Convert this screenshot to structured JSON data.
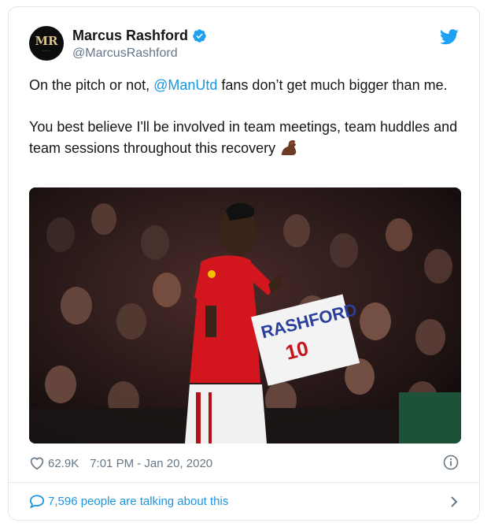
{
  "account": {
    "display_name": "Marcus Rashford",
    "handle": "@MarcusRashford",
    "avatar_monogram": "MR",
    "verified": true
  },
  "tweet": {
    "line1_before": "On the pitch or not, ",
    "mention": "@ManUtd",
    "line1_after": " fans don’t get much bigger than me.",
    "paragraph2": "You best believe I'll be involved in team meetings, team huddles and team sessions throughout this recovery ",
    "emoji": "flexed-biceps-icon"
  },
  "media": {
    "sign_line1": "RASHFORD",
    "sign_line2": "10"
  },
  "meta": {
    "likes": "62.9K",
    "timestamp": "7:01 PM - Jan 20, 2020"
  },
  "footer": {
    "talking": "7,596 people are talking about this"
  },
  "colors": {
    "accent": "#1b95e0",
    "verified": "#1da1f2",
    "text": "#14171a",
    "secondary": "#657786"
  }
}
